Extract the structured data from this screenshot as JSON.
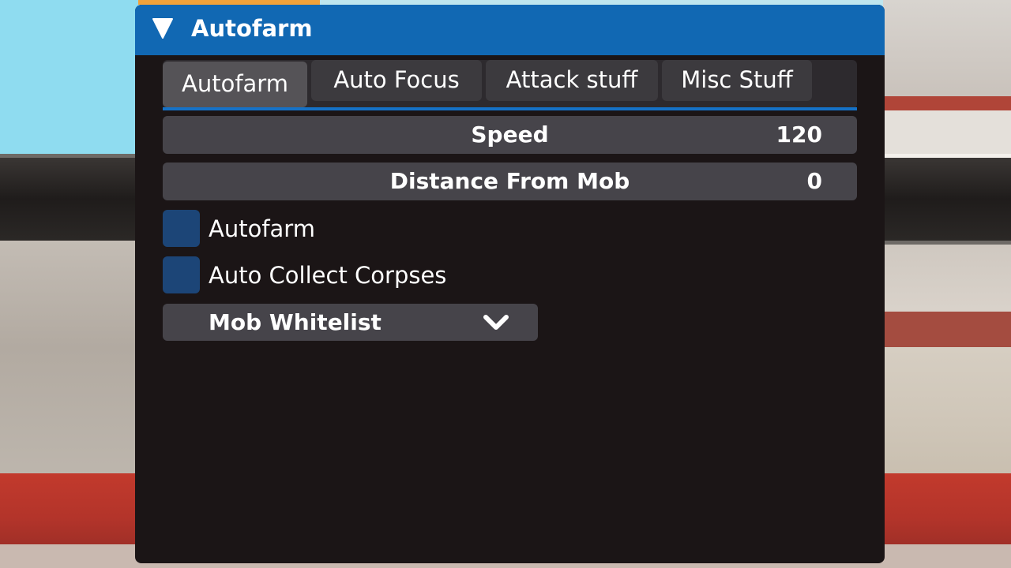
{
  "window": {
    "title": "Autofarm",
    "accent_color": "#1168b3"
  },
  "tabs": [
    {
      "label": "Autofarm",
      "active": true
    },
    {
      "label": "Auto Focus",
      "active": false
    },
    {
      "label": "Attack stuff",
      "active": false
    },
    {
      "label": "Misc Stuff",
      "active": false
    }
  ],
  "sliders": [
    {
      "label": "Speed",
      "value": "120"
    },
    {
      "label": "Distance From Mob",
      "value": "0"
    }
  ],
  "toggles": [
    {
      "label": "Autofarm",
      "checked": false
    },
    {
      "label": "Auto Collect Corpses",
      "checked": false
    }
  ],
  "dropdown": {
    "label": "Mob Whitelist",
    "icon": "chevron-down-icon"
  },
  "icons": {
    "collapse": "triangle-down-icon"
  }
}
